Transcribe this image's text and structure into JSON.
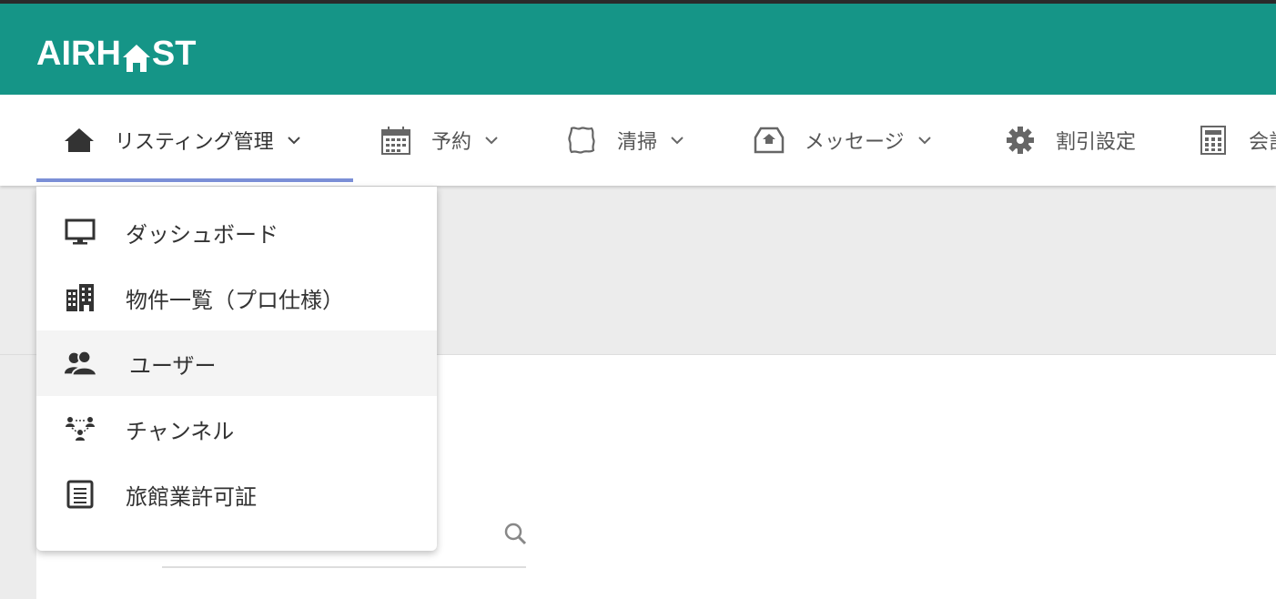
{
  "brand": {
    "logo_left": "AIRH",
    "logo_right": "ST"
  },
  "nav": {
    "items": [
      {
        "label": "リスティング管理",
        "icon": "home-icon",
        "has_dropdown": true
      },
      {
        "label": "予約",
        "icon": "calendar-icon",
        "has_dropdown": true
      },
      {
        "label": "清掃",
        "icon": "cleaning-icon",
        "has_dropdown": true
      },
      {
        "label": "メッセージ",
        "icon": "inbox-icon",
        "has_dropdown": true
      },
      {
        "label": "割引設定",
        "icon": "gear-icon",
        "has_dropdown": false
      },
      {
        "label": "会計",
        "icon": "calculator-icon",
        "has_dropdown": false
      }
    ]
  },
  "dropdown": {
    "items": [
      {
        "label": "ダッシュボード",
        "icon": "monitor-icon"
      },
      {
        "label": "物件一覧（プロ仕様）",
        "icon": "building-icon"
      },
      {
        "label": "ユーザー",
        "icon": "users-icon"
      },
      {
        "label": "チャンネル",
        "icon": "channel-network-icon"
      },
      {
        "label": "旅館業許可証",
        "icon": "document-icon"
      }
    ]
  },
  "colors": {
    "header": "#159587",
    "active_underline": "#7b8fd6",
    "hover_row": "#f4f4f4"
  }
}
